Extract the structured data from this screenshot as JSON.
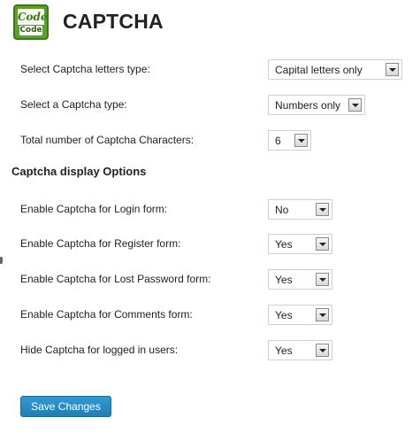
{
  "header": {
    "logo_top_text": "Code",
    "logo_bottom_text": "Code",
    "title": "CAPTCHA"
  },
  "settings": {
    "letters_type": {
      "label": "Select Captcha letters type:",
      "value": "Capital letters only"
    },
    "captcha_type": {
      "label": "Select a Captcha type:",
      "value": "Numbers only"
    },
    "total_chars": {
      "label": "Total number of Captcha Characters:",
      "value": "6"
    }
  },
  "display_options": {
    "title": "Captcha display Options",
    "login": {
      "label": "Enable Captcha for Login form:",
      "value": "No"
    },
    "register": {
      "label": "Enable Captcha for Register form:",
      "value": "Yes"
    },
    "lost_password": {
      "label": "Enable Captcha for Lost Password form:",
      "value": "Yes"
    },
    "comments": {
      "label": "Enable Captcha for Comments form:",
      "value": "Yes"
    },
    "hide_logged_in": {
      "label": "Hide Captcha for logged in users:",
      "value": "Yes"
    }
  },
  "actions": {
    "save_label": "Save Changes"
  },
  "colors": {
    "logo_green": "#5fa02d",
    "button_blue": "#217fb4"
  },
  "icons": {
    "logo": "code-captcha-logo-icon",
    "dropdown": "chevron-down-icon"
  }
}
